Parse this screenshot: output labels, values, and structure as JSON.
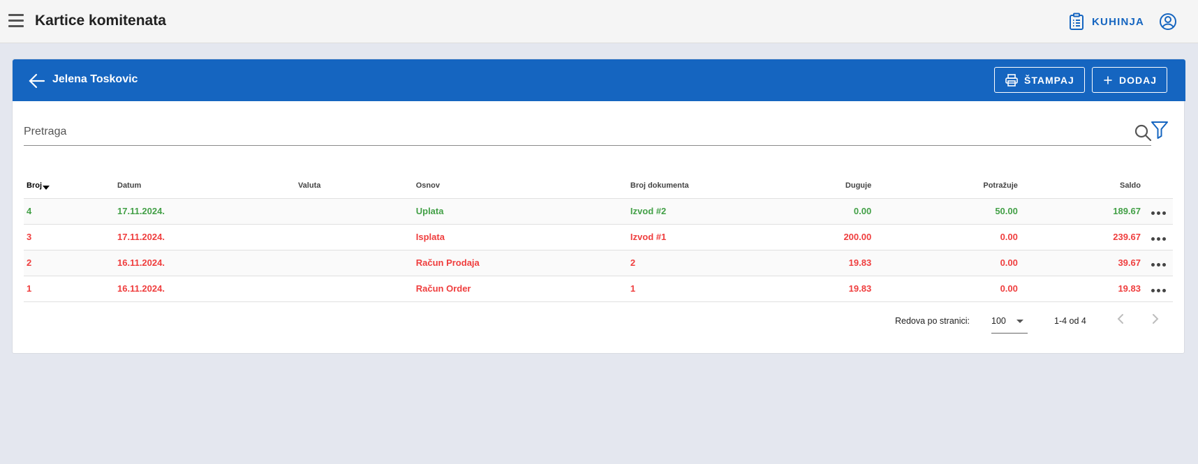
{
  "appbar": {
    "title": "Kartice komitenata",
    "kitchen_label": "KUHINJA"
  },
  "card": {
    "client_name": "Jelena Toskovic",
    "print_label": "ŠTAMPAJ",
    "add_label": "DODAJ"
  },
  "search": {
    "placeholder": "Pretraga"
  },
  "table": {
    "headers": {
      "broj": "Broj",
      "datum": "Datum",
      "valuta": "Valuta",
      "osnov": "Osnov",
      "broj_dokumenta": "Broj dokumenta",
      "duguje": "Duguje",
      "potrazuje": "Potražuje",
      "saldo": "Saldo"
    },
    "rows": [
      {
        "broj": "4",
        "datum": "17.11.2024.",
        "valuta": "",
        "osnov": "Uplata",
        "broj_dokumenta": "Izvod #2",
        "duguje": "0.00",
        "potrazuje": "50.00",
        "saldo": "189.67",
        "status": "green"
      },
      {
        "broj": "3",
        "datum": "17.11.2024.",
        "valuta": "",
        "osnov": "Isplata",
        "broj_dokumenta": "Izvod #1",
        "duguje": "200.00",
        "potrazuje": "0.00",
        "saldo": "239.67",
        "status": "red"
      },
      {
        "broj": "2",
        "datum": "16.11.2024.",
        "valuta": "",
        "osnov": "Račun Prodaja",
        "broj_dokumenta": "2",
        "duguje": "19.83",
        "potrazuje": "0.00",
        "saldo": "39.67",
        "status": "red"
      },
      {
        "broj": "1",
        "datum": "16.11.2024.",
        "valuta": "",
        "osnov": "Račun Order",
        "broj_dokumenta": "1",
        "duguje": "19.83",
        "potrazuje": "0.00",
        "saldo": "19.83",
        "status": "red"
      }
    ]
  },
  "pagination": {
    "rows_per_page_label": "Redova po stranici:",
    "rows_per_page_value": "100",
    "range_label": "1-4 od 4"
  },
  "colors": {
    "primary": "#1565c0",
    "positive": "#43a047",
    "negative": "#ef3e3e"
  },
  "icons": [
    "menu-icon",
    "clipboard-icon",
    "account-icon",
    "back-arrow-icon",
    "printer-icon",
    "plus-icon",
    "search-icon",
    "filter-icon",
    "more-icon",
    "chevron-left-icon",
    "chevron-right-icon"
  ]
}
